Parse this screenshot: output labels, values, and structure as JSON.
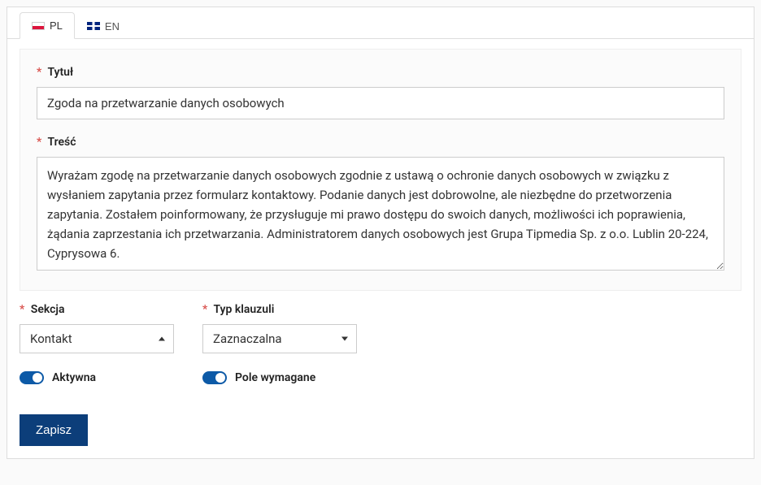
{
  "tabs": {
    "pl": "PL",
    "en": "EN"
  },
  "form": {
    "title_label": "Tytuł",
    "title_value": "Zgoda na przetwarzanie danych osobowych",
    "content_label": "Treść",
    "content_value": "Wyrażam zgodę na przetwarzanie danych osobowych zgodnie z ustawą o ochronie danych osobowych w związku z wysłaniem zapytania przez formularz kontaktowy. Podanie danych jest dobrowolne, ale niezbędne do przetworzenia zapytania. Zostałem poinformowany, że przysługuje mi prawo dostępu do swoich danych, możliwości ich poprawienia, żądania zaprzestania ich przetwarzania. Administratorem danych osobowych jest Grupa Tipmedia Sp. z o.o. Lublin 20-224, Cyprysowa 6."
  },
  "section": {
    "label": "Sekcja",
    "value": "Kontakt"
  },
  "clause_type": {
    "label": "Typ klauzuli",
    "value": "Zaznaczalna"
  },
  "toggles": {
    "active_label": "Aktywna",
    "required_label": "Pole wymagane"
  },
  "buttons": {
    "save": "Zapisz"
  }
}
